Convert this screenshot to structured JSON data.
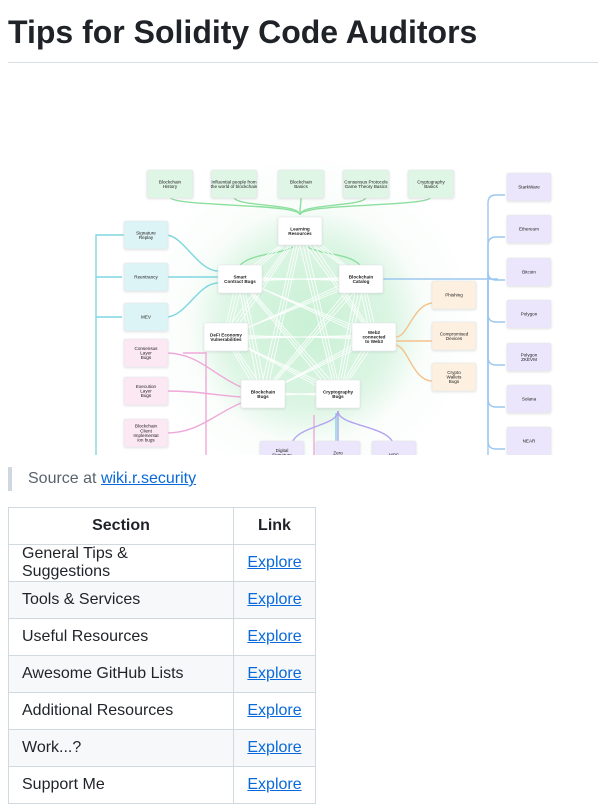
{
  "page": {
    "title": "Tips for Solidity Code Auditors"
  },
  "source": {
    "prefix": "Source at ",
    "link_text": "wiki.r.security"
  },
  "table": {
    "headers": [
      "Section",
      "Link"
    ],
    "rows": [
      {
        "section": "General Tips & Suggestions",
        "link": "Explore"
      },
      {
        "section": "Tools & Services",
        "link": "Explore"
      },
      {
        "section": "Useful Resources",
        "link": "Explore"
      },
      {
        "section": "Awesome GitHub Lists",
        "link": "Explore"
      },
      {
        "section": "Additional Resources",
        "link": "Explore"
      },
      {
        "section": "Work...?",
        "link": "Explore"
      },
      {
        "section": "Support Me",
        "link": "Explore"
      }
    ]
  },
  "diagram": {
    "top_nodes": [
      [
        "Blockchain",
        "History"
      ],
      [
        "Influential people from",
        "the world of blockchain"
      ],
      [
        "Blockchain",
        "Basics"
      ],
      [
        "Consensus Protocols",
        "Game Theory Basics"
      ],
      [
        "Cryptography",
        "Basics"
      ]
    ],
    "left_nodes": [
      [
        "Signature",
        "Replay"
      ],
      [
        "Reentrancy"
      ],
      [
        "MEV"
      ],
      [
        "Consensus",
        "Layer",
        "Bugs"
      ],
      [
        "Execution",
        "Layer",
        "Bugs"
      ],
      [
        "Blockchain",
        "Client",
        "Implementat",
        "ion bugs"
      ]
    ],
    "center_nodes": {
      "learning": [
        "Learning",
        "Resources"
      ],
      "smart": [
        "Smart",
        "Contract Bugs"
      ],
      "catalog": [
        "Blockchain",
        "Catalog"
      ],
      "defi": [
        "DeFi Economy",
        "Vulnerabilities"
      ],
      "web2": [
        "Web2",
        "connected",
        "to Web3"
      ],
      "bcbugs": [
        "Blockchain",
        "Bugs"
      ],
      "cryptobugs": [
        "Cryptography",
        "Bugs"
      ]
    },
    "right_mid_nodes": [
      [
        "Phishing"
      ],
      [
        "Compromised",
        "Devices"
      ],
      [
        "Crypto",
        "Wallets",
        "Bugs"
      ]
    ],
    "right_nodes": [
      [
        "StarkWare"
      ],
      [
        "Ethereum"
      ],
      [
        "Bitcoin"
      ],
      [
        "Polygon"
      ],
      [
        "Polygon",
        "ZKEVM"
      ],
      [
        "Solana"
      ],
      [
        "NEAR"
      ],
      [
        "Scroll"
      ]
    ],
    "bottom_nodes": [
      [
        "Digital",
        "Signature",
        "Bugs"
      ],
      [
        "Zero",
        "Knowledge"
      ],
      [
        "MPC"
      ]
    ],
    "colors": {
      "top": "#dff5e6",
      "left": "#ddf4f6",
      "left_pink": "#fbe8f3",
      "center": "#ffffff",
      "right_mid": "#fdf0e0",
      "right": "#ebe6fb",
      "bottom": "#ebe6fb",
      "glow": "#c8f0d4",
      "line_teal": "#7fd6e0",
      "line_green": "#8ddf9f",
      "line_pink": "#f0a8d8",
      "line_orange": "#f6c28a",
      "line_purple": "#b3a3ef",
      "line_blue": "#9cc7f0"
    }
  }
}
